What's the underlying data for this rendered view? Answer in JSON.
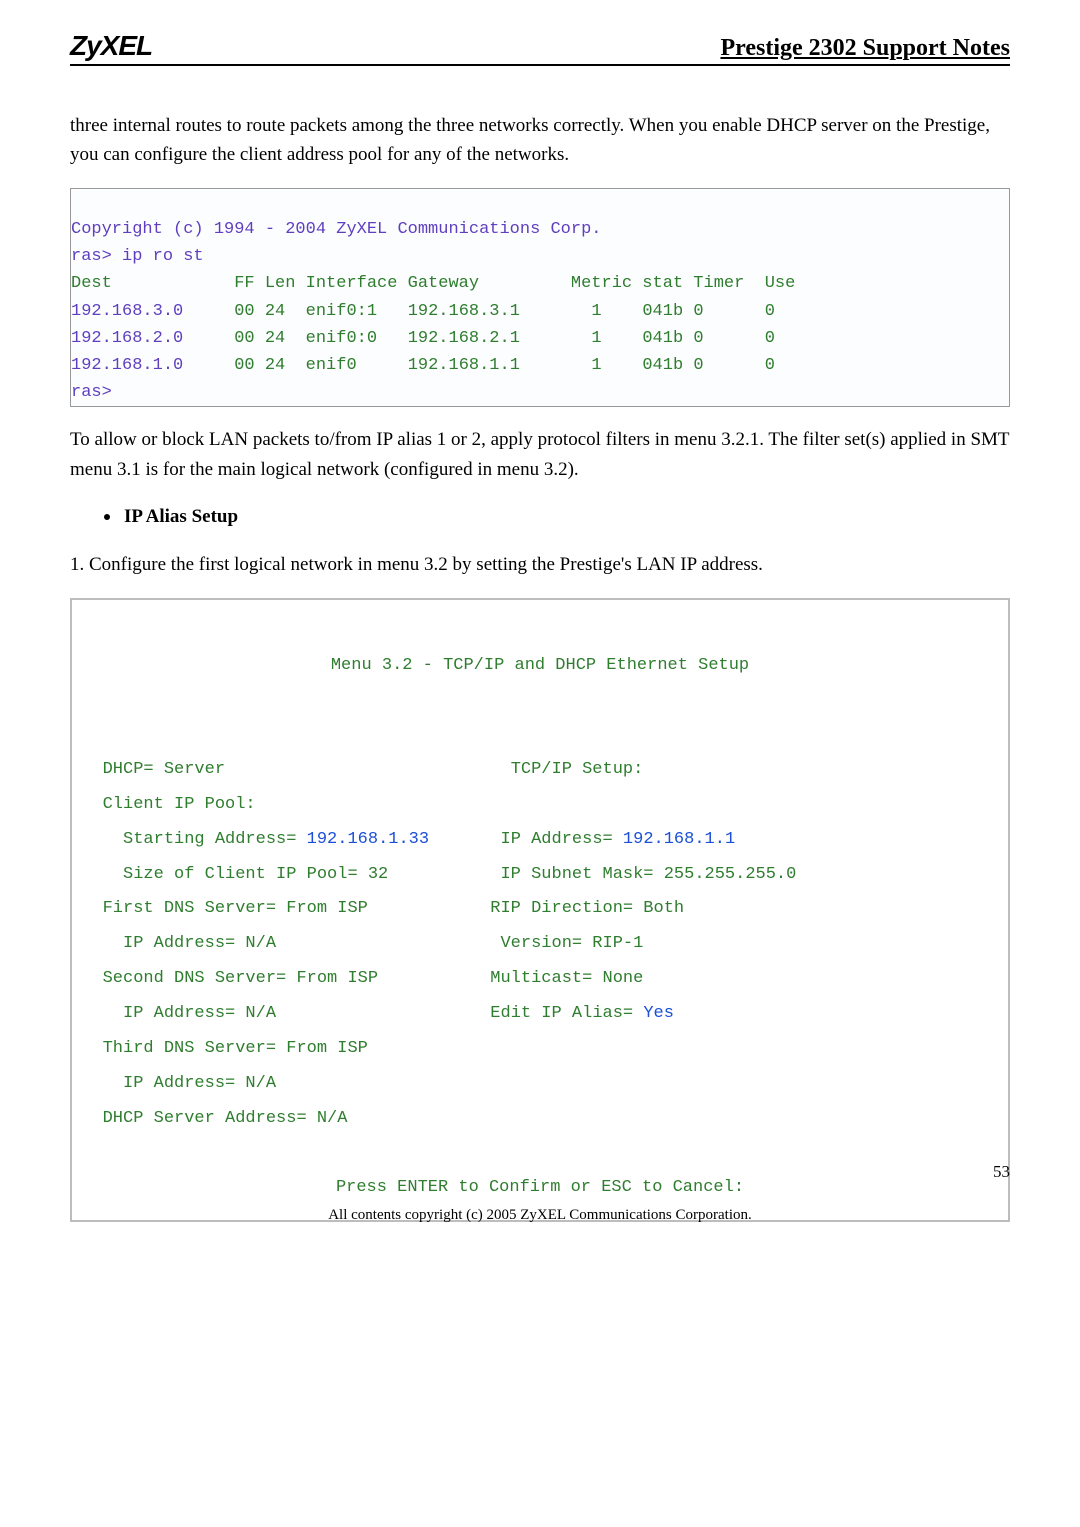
{
  "header": {
    "logo": "ZyXEL",
    "title": "Prestige 2302 Support Notes"
  },
  "para1": "three internal routes to route packets among the three networks correctly. When you enable DHCP server on the Prestige, you can configure the client address pool for any of the networks.",
  "code1": {
    "copyright": "Copyright (c) 1994 - 2004 ZyXEL Communications Corp.",
    "cmd": "ras> ip ro st",
    "header_row": "Dest            FF Len Interface Gateway         Metric stat Timer  Use",
    "rows": [
      {
        "dest": "192.168.3.0",
        "ff": "00",
        "len": "24",
        "iface": "enif0:1",
        "gw": "192.168.3.1",
        "metric": "1",
        "stat": "041b",
        "timer": "0",
        "use": "0"
      },
      {
        "dest": "192.168.2.0",
        "ff": "00",
        "len": "24",
        "iface": "enif0:0",
        "gw": "192.168.2.1",
        "metric": "1",
        "stat": "041b",
        "timer": "0",
        "use": "0"
      },
      {
        "dest": "192.168.1.0",
        "ff": "00",
        "len": "24",
        "iface": "enif0",
        "gw": "192.168.1.1",
        "metric": "1",
        "stat": "041b",
        "timer": "0",
        "use": "0"
      }
    ],
    "prompt": "ras>"
  },
  "para2": "To allow or block LAN packets to/from IP alias 1 or 2, apply protocol filters in menu 3.2.1. The filter set(s) applied in SMT menu 3.1 is for the main logical network (configured in menu 3.2).",
  "bullet": "IP Alias Setup",
  "para3": "1. Configure the first logical network in menu 3.2 by setting the Prestige's LAN IP address.",
  "menu": {
    "title": "Menu 3.2 - TCP/IP and DHCP Ethernet Setup",
    "dhcp_label": "DHCP= Server",
    "tcp_label": "TCP/IP Setup:",
    "client_pool": "Client IP Pool:",
    "start_addr_label": "Starting Address=",
    "start_addr_val": "192.168.1.33",
    "ip_addr_label": "IP Address=",
    "ip_addr_val": "192.168.1.1",
    "size_pool": "Size of Client IP Pool= 32",
    "subnet": "IP Subnet Mask= 255.255.255.0",
    "first_dns": "First DNS Server= From ISP",
    "rip_dir": "RIP Direction= Both",
    "ip_na1": "IP Address= N/A",
    "version": "Version= RIP-1",
    "second_dns": "Second DNS Server= From ISP",
    "multicast": "Multicast= None",
    "ip_na2": "IP Address= N/A",
    "edit_alias_label": "Edit IP Alias=",
    "edit_alias_val": "Yes",
    "third_dns": "Third DNS Server= From ISP",
    "ip_na3": "IP Address= N/A",
    "dhcp_server": "DHCP Server Address= N/A",
    "press_enter": "Press ENTER to Confirm or ESC to Cancel:"
  },
  "footer": "All contents copyright (c) 2005 ZyXEL Communications Corporation.",
  "page": "53"
}
